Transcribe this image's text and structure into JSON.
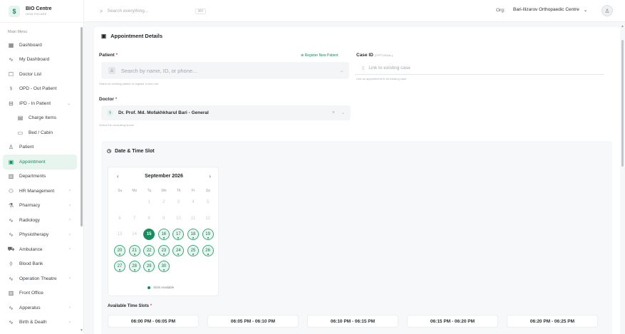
{
  "brand": {
    "logo": "$",
    "name": "BIO Centre",
    "sub": "HEALTHCARE"
  },
  "sidebar": {
    "menu_title": "Main Menu",
    "items": [
      {
        "label": "Dashboard",
        "icon": "▦"
      },
      {
        "label": "My Dashboard",
        "icon": "∿"
      },
      {
        "label": "Doctor List",
        "icon": "☐"
      },
      {
        "label": "OPD - Out Patient",
        "icon": "⚕"
      },
      {
        "label": "IPD - In Patient",
        "icon": "⊟",
        "chev": "⌄"
      },
      {
        "label": "Charge Items",
        "icon": "▤"
      },
      {
        "label": "Bed / Cabin",
        "icon": "▭"
      },
      {
        "label": "Patient",
        "icon": "♙"
      },
      {
        "label": "Appointment",
        "icon": "▣"
      },
      {
        "label": "Departments",
        "icon": "▥"
      },
      {
        "label": "HR Management",
        "icon": "⚇",
        "chev": "›"
      },
      {
        "label": "Pharmacy",
        "icon": "⚗",
        "chev": "›"
      },
      {
        "label": "Radiology",
        "icon": "∿",
        "chev": "›"
      },
      {
        "label": "Physiotherapy",
        "icon": "∿",
        "chev": "›"
      },
      {
        "label": "Ambulance",
        "icon": "⛟",
        "chev": "›"
      },
      {
        "label": "Blood Bank",
        "icon": "◊"
      },
      {
        "label": "Operation Theatre",
        "icon": "∿",
        "chev": "›"
      },
      {
        "label": "Front Office",
        "icon": "▥"
      },
      {
        "label": "Apperatus",
        "icon": "∿",
        "chev": "›"
      },
      {
        "label": "Birth & Death",
        "icon": "∿",
        "chev": "›"
      }
    ]
  },
  "topbar": {
    "search_placeholder": "Search everything...",
    "kbd": "⌘K",
    "org_label": "Org:",
    "org_value": "Bari-Ilizarov Orthopaedic Centre",
    "org_chev": "⌄",
    "avatar": "♙"
  },
  "card": {
    "title": "Appointment Details",
    "title_icon": "▣",
    "patient": {
      "label": "Patient",
      "req": "*",
      "link": "⊕ Register New Patient",
      "placeholder": "Search by name, ID, or phone...",
      "icon": "♙",
      "hint": "Select an existing patient or register a new one"
    },
    "case": {
      "label": "Case ID",
      "opt": "(OPTIONAL)",
      "placeholder": "Link to existing case",
      "icon": "▯",
      "hint": "Link an appointment to an existing case"
    },
    "doctor": {
      "label": "Doctor",
      "req": "*",
      "value": "Dr. Prof. Md. Mofakhkharul Bari - General",
      "icon": "⚕",
      "clear": "×",
      "chev": "⌄",
      "hint": "Select the consulting doctor"
    }
  },
  "datetime": {
    "title": "Date & Time Slot",
    "icon": "◷",
    "calendar": {
      "month": "September 2026",
      "prev": "‹",
      "next": "›",
      "weekdays": [
        "Su",
        "Mo",
        "Tu",
        "We",
        "Th",
        "Fr",
        "Sa"
      ],
      "legend": "Slots Available",
      "days": [
        {
          "d": "1",
          "r": 0,
          "c": 2,
          "s": "past"
        },
        {
          "d": "2",
          "r": 0,
          "c": 3,
          "s": "past"
        },
        {
          "d": "3",
          "r": 0,
          "c": 4,
          "s": "past"
        },
        {
          "d": "4",
          "r": 0,
          "c": 5,
          "s": "past"
        },
        {
          "d": "5",
          "r": 0,
          "c": 6,
          "s": "past"
        },
        {
          "d": "6",
          "r": 1,
          "c": 0,
          "s": "past"
        },
        {
          "d": "7",
          "r": 1,
          "c": 1,
          "s": "past"
        },
        {
          "d": "8",
          "r": 1,
          "c": 2,
          "s": "past"
        },
        {
          "d": "9",
          "r": 1,
          "c": 3,
          "s": "past"
        },
        {
          "d": "10",
          "r": 1,
          "c": 4,
          "s": "past"
        },
        {
          "d": "11",
          "r": 1,
          "c": 5,
          "s": "past"
        },
        {
          "d": "12",
          "r": 1,
          "c": 6,
          "s": "past"
        },
        {
          "d": "13",
          "r": 2,
          "c": 0,
          "s": "past"
        },
        {
          "d": "14",
          "r": 2,
          "c": 1,
          "s": "past"
        },
        {
          "d": "15",
          "r": 2,
          "c": 2,
          "s": "sel"
        },
        {
          "d": "16",
          "r": 2,
          "c": 3,
          "s": "avail"
        },
        {
          "d": "17",
          "r": 2,
          "c": 4,
          "s": "avail"
        },
        {
          "d": "18",
          "r": 2,
          "c": 5,
          "s": "avail"
        },
        {
          "d": "19",
          "r": 2,
          "c": 6,
          "s": "avail"
        },
        {
          "d": "20",
          "r": 3,
          "c": 0,
          "s": "avail"
        },
        {
          "d": "21",
          "r": 3,
          "c": 1,
          "s": "avail"
        },
        {
          "d": "22",
          "r": 3,
          "c": 2,
          "s": "avail"
        },
        {
          "d": "23",
          "r": 3,
          "c": 3,
          "s": "avail"
        },
        {
          "d": "24",
          "r": 3,
          "c": 4,
          "s": "avail"
        },
        {
          "d": "25",
          "r": 3,
          "c": 5,
          "s": "avail"
        },
        {
          "d": "26",
          "r": 3,
          "c": 6,
          "s": "avail"
        },
        {
          "d": "27",
          "r": 4,
          "c": 0,
          "s": "avail"
        },
        {
          "d": "28",
          "r": 4,
          "c": 1,
          "s": "avail"
        },
        {
          "d": "29",
          "r": 4,
          "c": 2,
          "s": "avail"
        },
        {
          "d": "30",
          "r": 4,
          "c": 3,
          "s": "avail"
        }
      ]
    },
    "slots_label": "Available Time Slots",
    "slots_req": "*",
    "slots": [
      "06:00 PM - 06:05 PM",
      "06:05 PM - 06:10 PM",
      "06:10 PM - 06:15 PM",
      "06:15 PM - 06:20 PM",
      "06:20 PM - 06:25 PM"
    ]
  },
  "colors": {
    "accent": "#1a8a5f",
    "accent_light": "#e7f5ef"
  }
}
